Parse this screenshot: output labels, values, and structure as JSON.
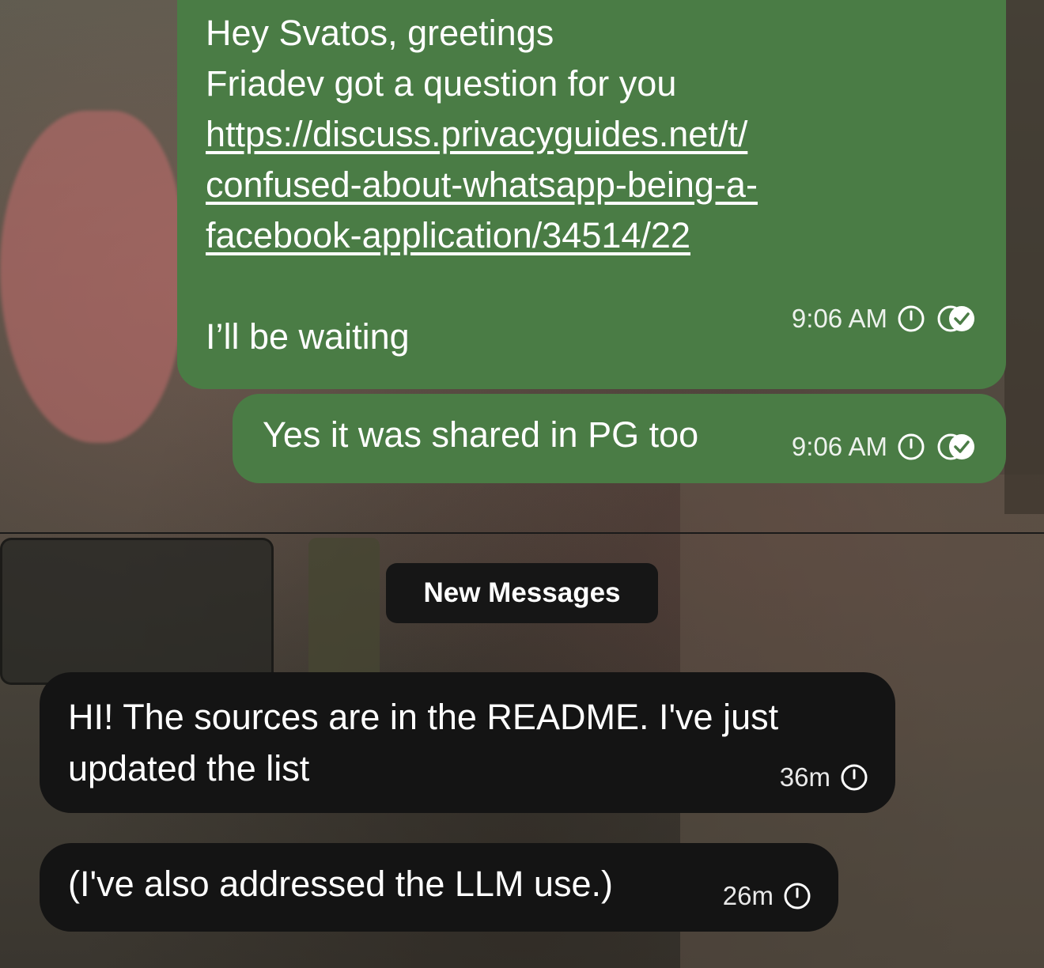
{
  "messages": [
    {
      "direction": "outgoing",
      "lines": [
        "Hey Svatos, greetings",
        "Friadev got a question for you"
      ],
      "link_lines": [
        "https://discuss.privacyguides.net/t/",
        "confused-about-whatsapp-being-a-",
        "facebook-application/34514/22"
      ],
      "closing": "I’ll be waiting",
      "time": "9:06 AM",
      "status_icons": [
        "timer-icon",
        "read-receipt-icon"
      ]
    },
    {
      "direction": "outgoing",
      "text": "Yes it was shared in PG too",
      "time": "9:06 AM",
      "status_icons": [
        "timer-icon",
        "read-receipt-icon"
      ]
    },
    {
      "direction": "incoming",
      "lines": [
        "HI! The sources are in the README. I've just",
        "updated the list"
      ],
      "time": "36m",
      "status_icons": [
        "timer-icon"
      ]
    },
    {
      "direction": "incoming",
      "text": "(I've also addressed the LLM use.)",
      "time": "26m",
      "status_icons": [
        "timer-icon"
      ]
    }
  ],
  "separator": {
    "label": "New Messages"
  },
  "colors": {
    "outgoing_bubble": "#4a7c45",
    "incoming_bubble": "#141414",
    "text": "#ffffff"
  }
}
